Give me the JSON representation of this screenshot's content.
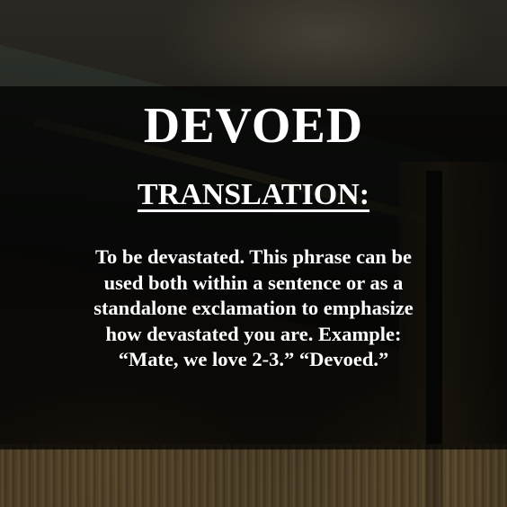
{
  "title": "DEVOED",
  "subtitle": "TRANSLATION:",
  "definition_lines": [
    "To be devastated. This phrase can be",
    "used both within a sentence or as a",
    "standalone exclamation to emphasize",
    "how devastated you are. Example:",
    "“Mate, we love 2-3.” “Devoed.”"
  ],
  "colors": {
    "text": "#ffffff",
    "overlay": "rgba(0,0,0,0.72)"
  }
}
